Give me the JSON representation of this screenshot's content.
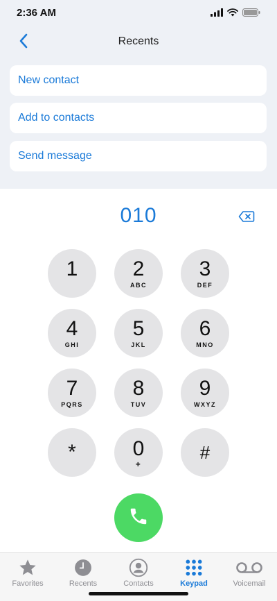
{
  "status": {
    "time": "2:36 AM"
  },
  "nav": {
    "title": "Recents"
  },
  "actions": [
    {
      "label": "New contact"
    },
    {
      "label": "Add to contacts"
    },
    {
      "label": "Send message"
    }
  ],
  "dialer": {
    "number": "010"
  },
  "keys": [
    {
      "digit": "1",
      "letters": ""
    },
    {
      "digit": "2",
      "letters": "ABC"
    },
    {
      "digit": "3",
      "letters": "DEF"
    },
    {
      "digit": "4",
      "letters": "GHI"
    },
    {
      "digit": "5",
      "letters": "JKL"
    },
    {
      "digit": "6",
      "letters": "MNO"
    },
    {
      "digit": "7",
      "letters": "PQRS"
    },
    {
      "digit": "8",
      "letters": "TUV"
    },
    {
      "digit": "9",
      "letters": "WXYZ"
    },
    {
      "digit": "*",
      "letters": ""
    },
    {
      "digit": "0",
      "letters": "+"
    },
    {
      "digit": "#",
      "letters": ""
    }
  ],
  "tabs": [
    {
      "label": "Favorites",
      "icon": "star-icon"
    },
    {
      "label": "Recents",
      "icon": "clock-icon"
    },
    {
      "label": "Contacts",
      "icon": "person-circle-icon"
    },
    {
      "label": "Keypad",
      "icon": "keypad-grid-icon"
    },
    {
      "label": "Voicemail",
      "icon": "voicemail-icon"
    }
  ],
  "colors": {
    "accent": "#1a7ad8",
    "call": "#4cd964",
    "key": "#e4e4e6",
    "top_bg": "#eef1f6"
  }
}
